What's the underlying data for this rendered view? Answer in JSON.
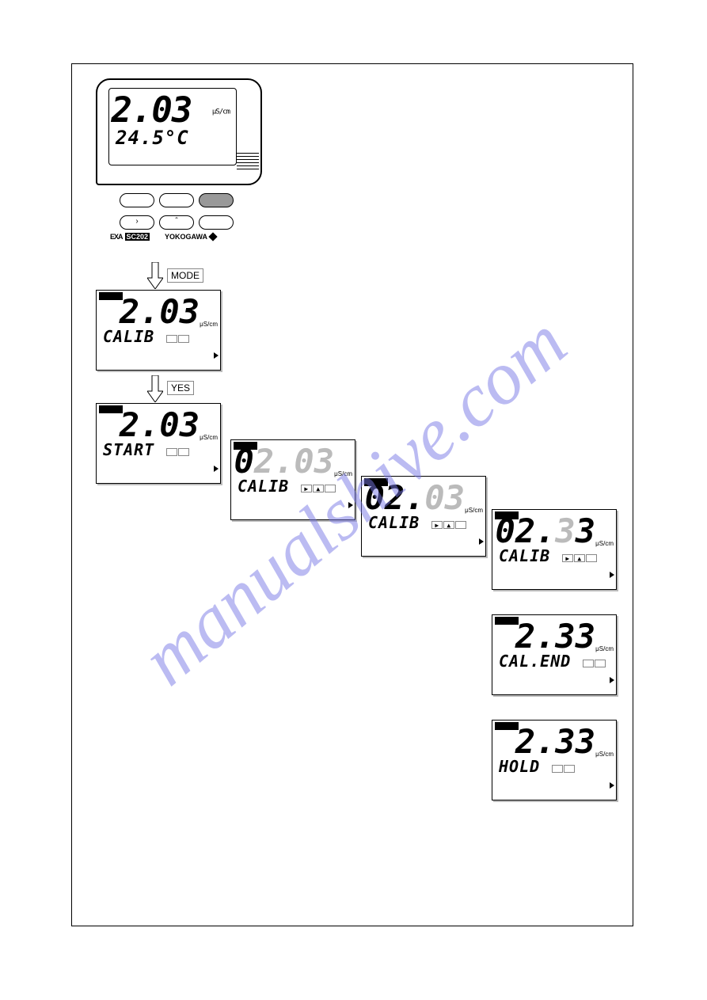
{
  "watermark": "manualshive.com",
  "device": {
    "main_value": "2.03",
    "main_unit": "μS/cm",
    "sub_value": "24.5°C",
    "brand_exa": "EXA",
    "brand_model": "SC202",
    "brand_mfr": "YOKOGAWA"
  },
  "keys": {
    "mode": "MODE",
    "yes": "YES"
  },
  "screens": [
    {
      "pos": "s1",
      "main": "2.03",
      "sub": "CALIB",
      "boxes": 2,
      "icons": false
    },
    {
      "pos": "s2",
      "main": "2.03",
      "sub": "START",
      "boxes": 2,
      "icons": false
    },
    {
      "pos": "s3",
      "mainL": "0",
      "mainD": "2.03",
      "sub": "CALIB",
      "boxes": 3,
      "icons": true
    },
    {
      "pos": "s4",
      "mainL": "02.",
      "mainD": "03",
      "sub": "CALIB",
      "boxes": 3,
      "icons": true
    },
    {
      "pos": "s5",
      "mainL": "02.",
      "mainD": "33",
      "sub": "CALIB",
      "boxes": 3,
      "icons": true,
      "mid33": true
    },
    {
      "pos": "s6",
      "main": "2.33",
      "sub": "CAL.END",
      "boxes": 2,
      "icons": false
    },
    {
      "pos": "s7",
      "main": "2.33",
      "sub": "HOLD",
      "boxes": 2,
      "icons": false
    }
  ]
}
